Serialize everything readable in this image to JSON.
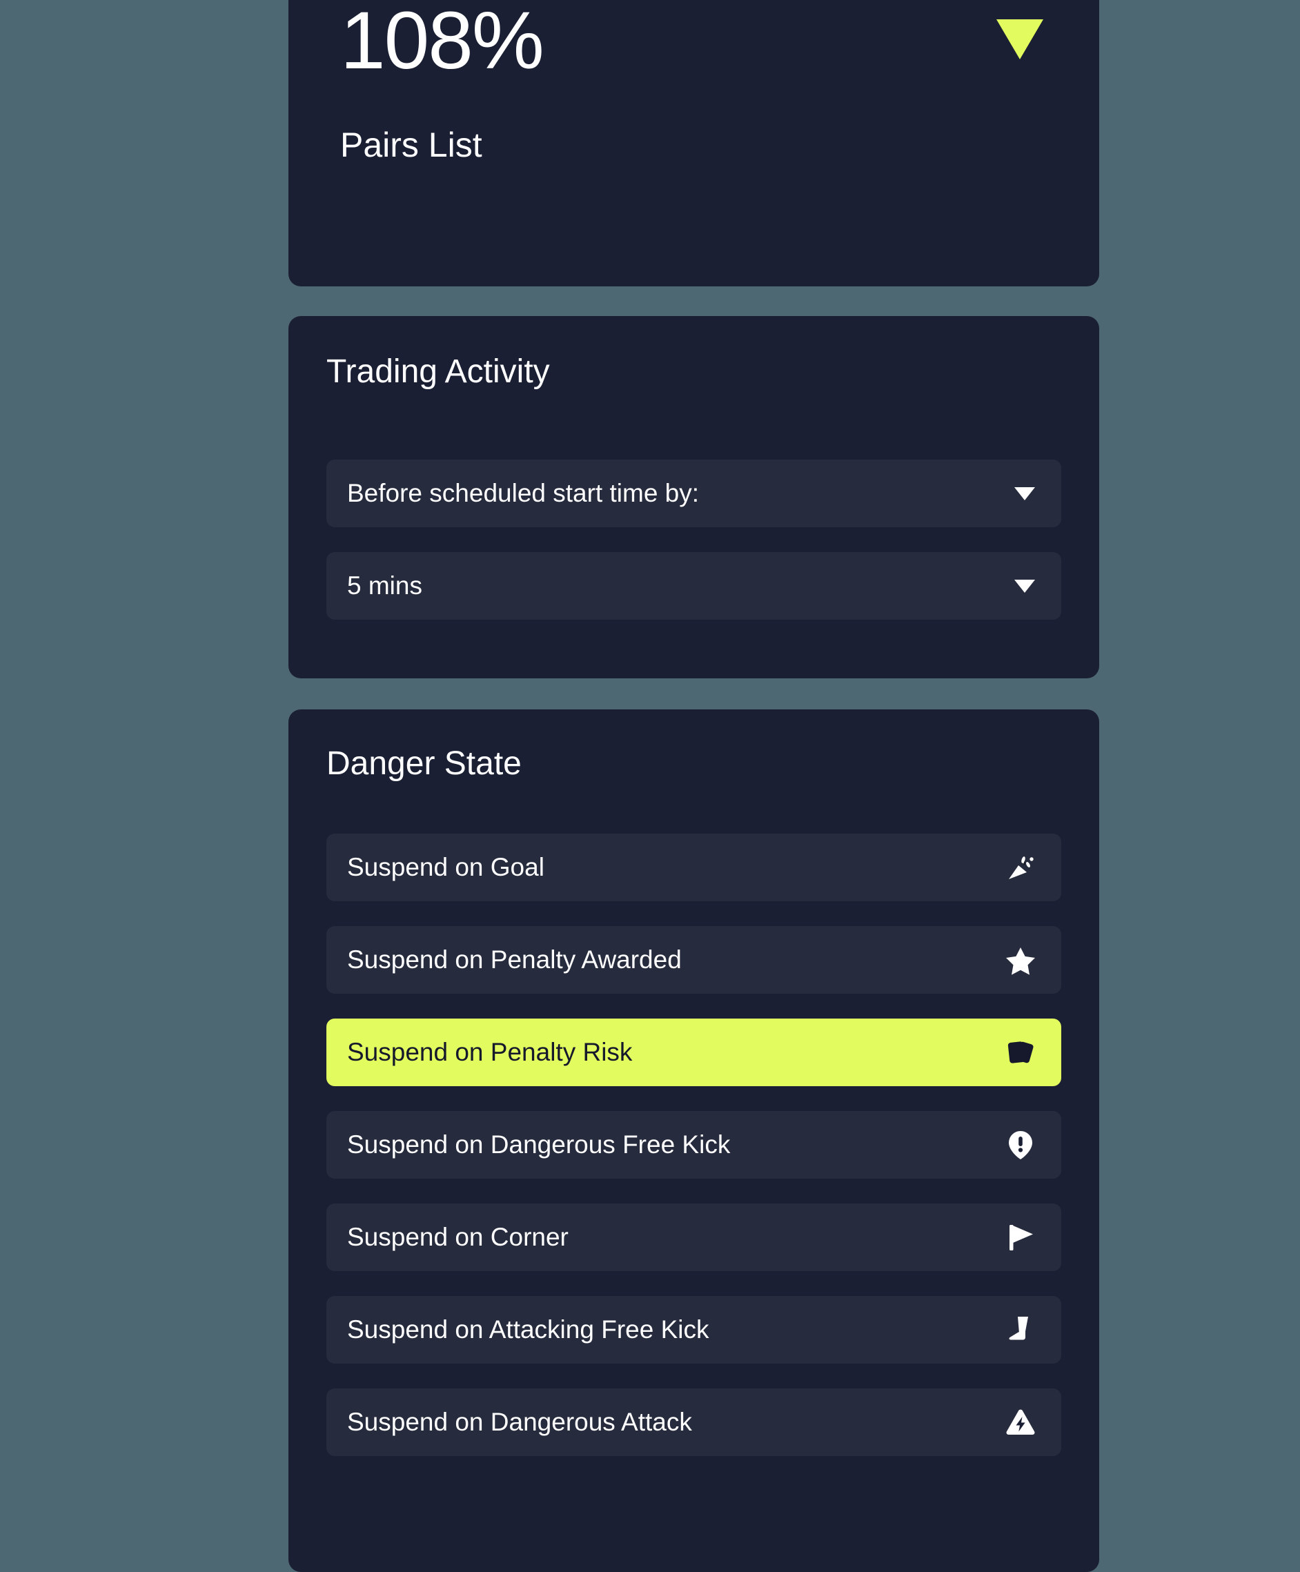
{
  "summary": {
    "value": "108%",
    "label": "Pairs List",
    "trend_direction": "down",
    "trend_color": "#e2fb5e"
  },
  "trading_activity": {
    "title": "Trading Activity",
    "fields": [
      {
        "name": "trigger-mode",
        "value": "Before scheduled start time by:"
      },
      {
        "name": "offset",
        "value": "5 mins"
      }
    ]
  },
  "danger_state": {
    "title": "Danger State",
    "selected_color": "#e2fb5e",
    "rows": [
      {
        "label": "Suspend on Goal",
        "icon": "party-popper-icon",
        "selected": false
      },
      {
        "label": "Suspend on Penalty Awarded",
        "icon": "star-icon",
        "selected": false
      },
      {
        "label": "Suspend on Penalty Risk",
        "icon": "cards-icon",
        "selected": true
      },
      {
        "label": "Suspend on Dangerous Free Kick",
        "icon": "alert-pin-icon",
        "selected": false
      },
      {
        "label": "Suspend on Corner",
        "icon": "corner-flag-icon",
        "selected": false
      },
      {
        "label": "Suspend on Attacking Free Kick",
        "icon": "boot-icon",
        "selected": false
      },
      {
        "label": "Suspend on Dangerous Attack",
        "icon": "hazard-bolt-icon",
        "selected": false
      }
    ]
  },
  "theme": {
    "page_background": "#4d6872",
    "card_background": "#1a1f33",
    "row_background": "#262b3d",
    "accent": "#e2fb5e",
    "text": "#ffffff"
  }
}
